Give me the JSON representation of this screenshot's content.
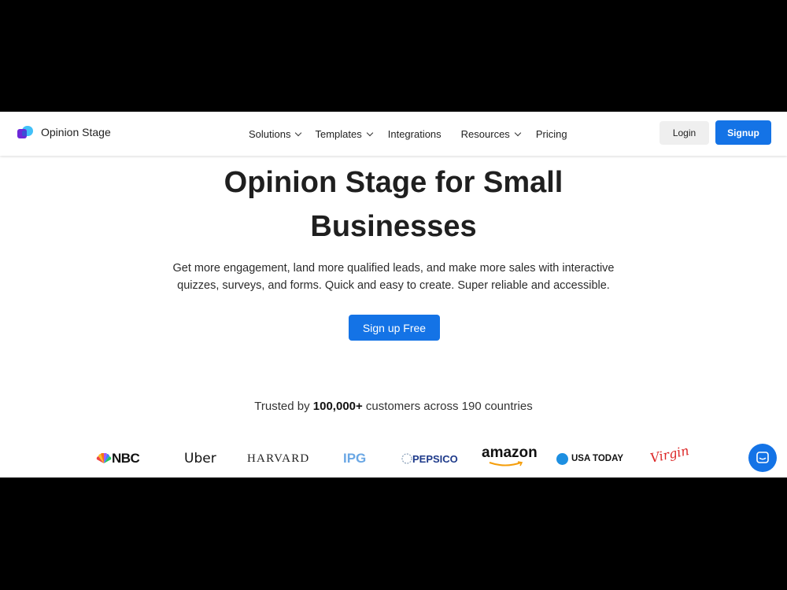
{
  "brand": {
    "name": "Opinion Stage"
  },
  "nav": {
    "items": [
      {
        "label": "Solutions",
        "dropdown": true
      },
      {
        "label": "Templates",
        "dropdown": true
      },
      {
        "label": "Integrations",
        "dropdown": false
      },
      {
        "label": "Resources",
        "dropdown": true
      },
      {
        "label": "Pricing",
        "dropdown": false
      }
    ],
    "login_label": "Login",
    "signup_label": "Signup"
  },
  "hero": {
    "title_line1": "Opinion Stage for Small",
    "title_line2": "Businesses",
    "subtitle_line1": "Get more engagement, land more qualified leads, and make more sales with interactive",
    "subtitle_line2": "quizzes, surveys, and forms. Quick and easy to create. Super reliable and accessible.",
    "cta_label": "Sign up Free"
  },
  "trusted": {
    "prefix": "Trusted by ",
    "count": "100,000+",
    "suffix": " customers across 190 countries"
  },
  "customer_logos": [
    "NBC",
    "Uber",
    "HARVARD",
    "IPG",
    "PEPSICO",
    "amazon",
    "USA TODAY",
    "Virgin"
  ],
  "colors": {
    "primary": "#1473e6",
    "text": "#1f1f1f",
    "logo_purple": "#6d28d9",
    "logo_cyan": "#38bdf8"
  },
  "icons": {
    "chat": "chat-bubble-icon",
    "chevron": "chevron-down-icon"
  }
}
